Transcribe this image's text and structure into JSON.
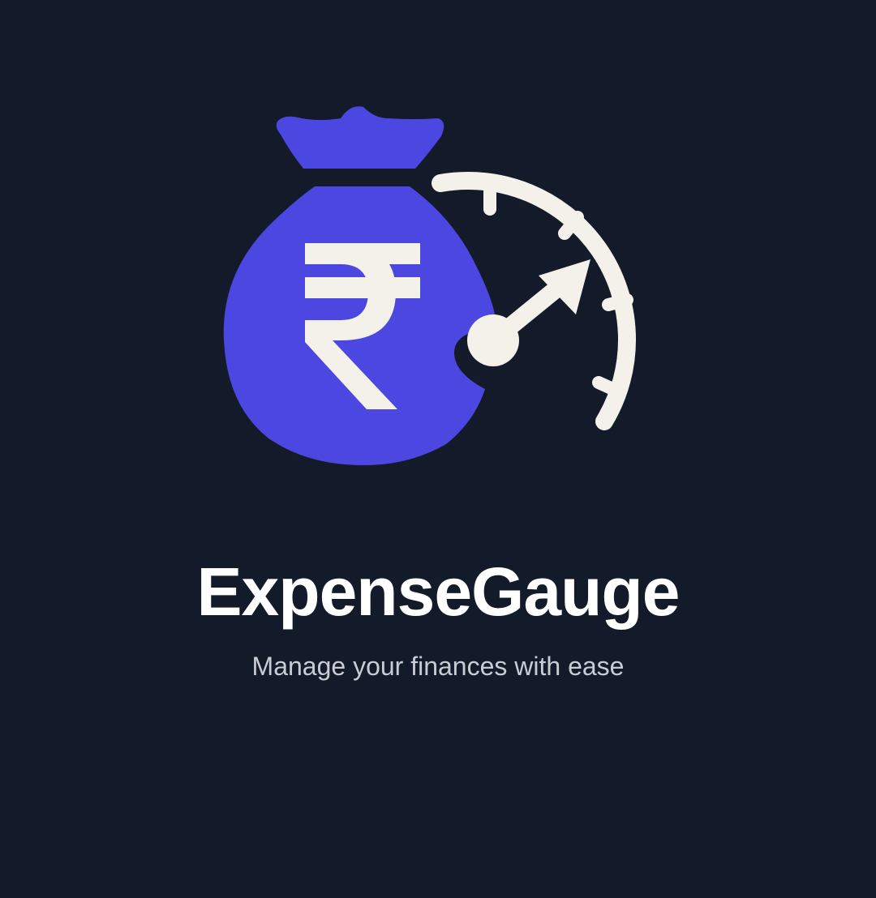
{
  "colors": {
    "background": "#131a29",
    "bag": "#4c47e0",
    "gauge": "#f4f1ea",
    "title": "#ffffff",
    "subtitle": "#c9ccd3"
  },
  "logo": {
    "icons": [
      "money-bag-icon",
      "rupee-symbol-icon",
      "speedometer-gauge-icon"
    ]
  },
  "app": {
    "title": "ExpenseGauge",
    "subtitle": "Manage your finances with ease"
  }
}
